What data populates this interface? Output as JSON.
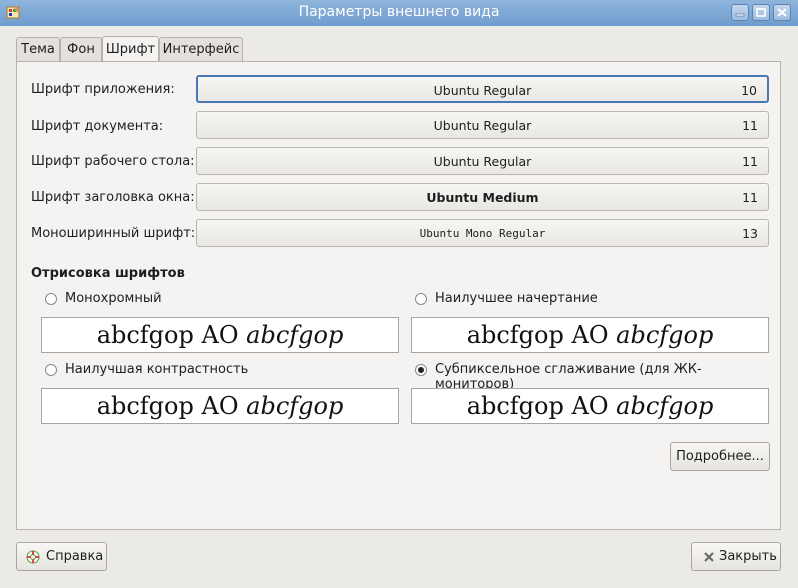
{
  "window": {
    "title": "Параметры внешнего вида"
  },
  "tabs": [
    "Тема",
    "Фон",
    "Шрифт",
    "Интерфейс"
  ],
  "active_tab": "Шрифт",
  "fonts": [
    {
      "label": "Шрифт приложения:",
      "name": "Ubuntu Regular",
      "size": "10"
    },
    {
      "label": "Шрифт документа:",
      "name": "Ubuntu Regular",
      "size": "11"
    },
    {
      "label": "Шрифт рабочего стола:",
      "name": "Ubuntu Regular",
      "size": "11"
    },
    {
      "label": "Шрифт заголовка окна:",
      "name": "Ubuntu Medium",
      "size": "11"
    },
    {
      "label": "Моноширинный шрифт:",
      "name": "Ubuntu Mono Regular",
      "size": "13"
    }
  ],
  "rendering": {
    "title": "Отрисовка шрифтов",
    "options": [
      {
        "label": "Монохромный",
        "checked": false
      },
      {
        "label": "Наилучшее начертание",
        "checked": false
      },
      {
        "label": "Наилучшая контрастность",
        "checked": false
      },
      {
        "label": "Субпиксельное сглаживание (для ЖК-мониторов)",
        "checked": true
      }
    ],
    "sample_regular": "abcfgop AO",
    "sample_italic": "abcfgop"
  },
  "buttons": {
    "details": "Подробнее...",
    "help": "Справка",
    "close": "Закрыть"
  },
  "colors": {
    "titlebar": "#7fa8d6",
    "focus_border": "#4a78b5"
  },
  "icons": {
    "app": "appearance-icon",
    "help": "help-lifebuoy-icon",
    "close": "close-x-icon"
  }
}
